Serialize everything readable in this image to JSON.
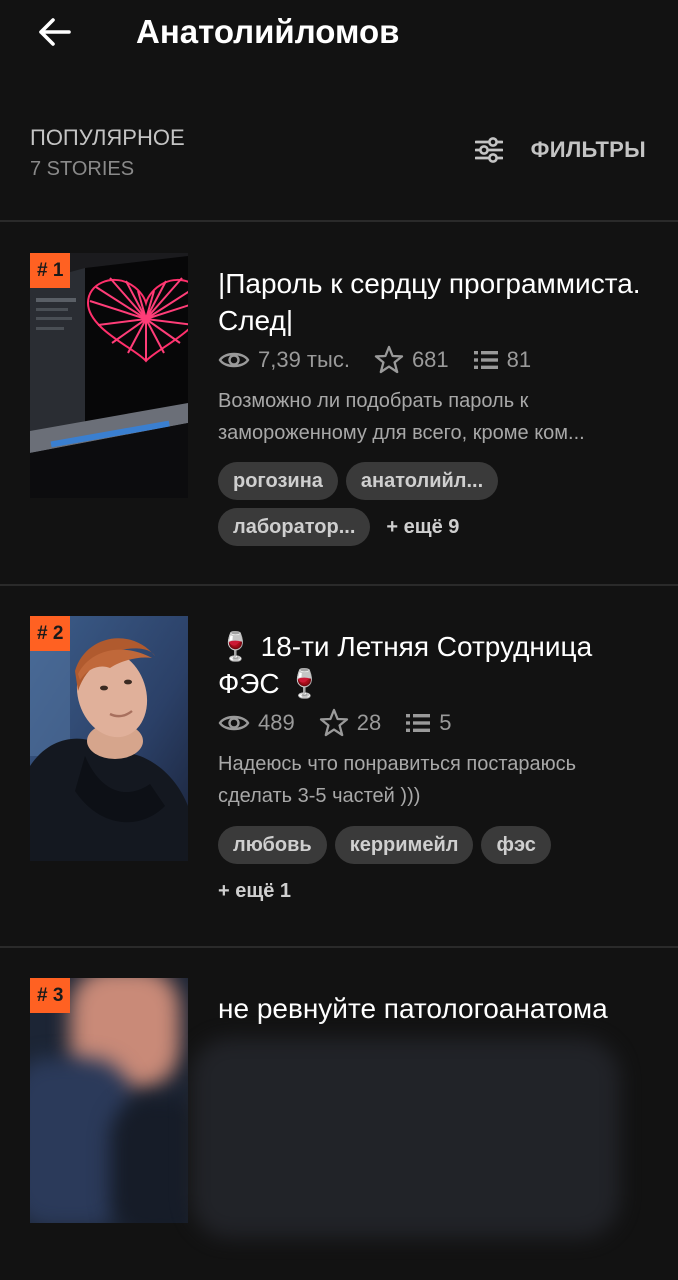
{
  "header": {
    "title": "Анатолийломов"
  },
  "sort": {
    "label": "ПОПУЛЯРНОЕ",
    "count": "7 STORIES"
  },
  "filters": {
    "label": "ФИЛЬТРЫ"
  },
  "stories": [
    {
      "rank": "# 1",
      "title": "|Пароль к сердцу программиста. След|",
      "reads": "7,39 тыс.",
      "votes": "681",
      "parts": "81",
      "description": "Возможно ли подобрать пароль к замороженному для всего, кроме ком...",
      "tags": [
        "рогозина",
        "анатолийл...",
        "лаборатор..."
      ],
      "more_tags": "+ ещё 9"
    },
    {
      "rank": "# 2",
      "title": "🍷 18-ти Летняя Сотрудница ФЭС 🍷",
      "reads": "489",
      "votes": "28",
      "parts": "5",
      "description": "Надеюсь что понравиться постараюсь сделать 3-5 частей )))",
      "tags": [
        "любовь",
        "керримейл",
        "фэс"
      ],
      "more_tags": "+ ещё 1"
    },
    {
      "rank": "# 3",
      "title": "не ревнуйте патологоанатома"
    }
  ],
  "colors": {
    "background": "#121212",
    "accent": "#ff6122",
    "tag_bg": "#3a3a3a",
    "divider": "#2a2a2a"
  },
  "icons": {
    "back": "arrow-left-icon",
    "filters": "sliders-icon",
    "reads": "eye-icon",
    "votes": "star-icon",
    "parts": "list-icon"
  }
}
